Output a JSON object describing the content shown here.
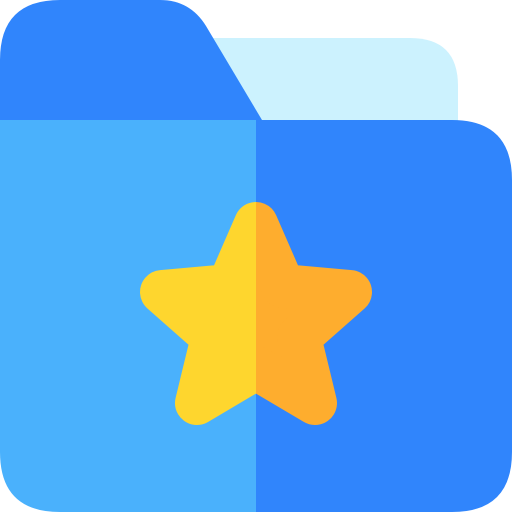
{
  "icon": {
    "name": "starred-folder",
    "parts": [
      "folder-back-tab",
      "folder-paper",
      "folder-front",
      "star"
    ]
  },
  "colors": {
    "tab_blue": "#3085FC",
    "paper_light": "#CCF2FE",
    "front_left_blue": "#4AB1FC",
    "front_right_blue": "#3085FC",
    "star_left_yellow": "#FED62E",
    "star_right_orange": "#FEAD2E"
  }
}
